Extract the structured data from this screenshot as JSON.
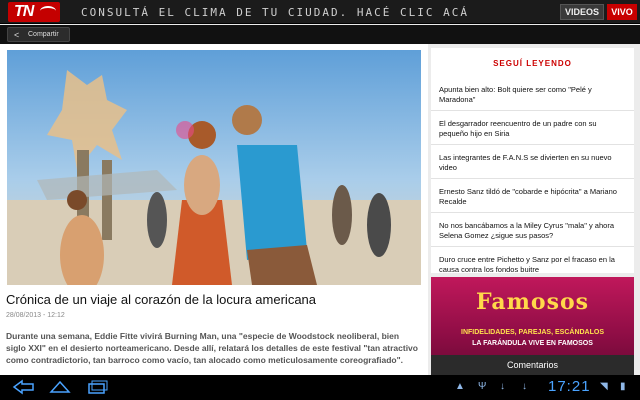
{
  "header": {
    "logo_text": "TN",
    "ticker": "CONSULTÁ EL CLIMA DE TU CIUDAD. HACÉ CLIC ACÁ",
    "videos_label": "VIDEOS",
    "vivo_label": "VIVO"
  },
  "share": {
    "label": "Compartir",
    "icon": "share-icon"
  },
  "article": {
    "title": "Crónica de un viaje al corazón de la locura americana",
    "date": "28/08/2013 - 12:12",
    "lead": "Durante una semana, Eddie Fitte vivirá Burning Man, una \"especie de Woodstock neoliberal, bien siglo XXI\" en el desierto norteamericano. Desde allí, relatará los detalles de este festival \"tan atractivo como contradictorio, tan barroco como vacío, tan alocado como meticulosamente coreografiado\"."
  },
  "sidebar": {
    "title": "SEGUÍ LEYENDO",
    "items": [
      {
        "label": "Apunta bien alto: Bolt quiere ser como \"Pelé y Maradona\""
      },
      {
        "label": "El desgarrador reencuentro de un padre con su pequeño hijo en Siria"
      },
      {
        "label": "Las integrantes de F.A.N.S se divierten en su nuevo video"
      },
      {
        "label": "Ernesto Sanz tildó de \"cobarde e hipócrita\" a Mariano Recalde"
      },
      {
        "label": "No nos bancábamos a la Miley Cyrus \"mala\" y ahora Selena Gomez ¿sigue sus pasos?"
      },
      {
        "label": "Duro cruce entre Pichetto y Sanz por el fracaso en la causa contra los fondos buitre"
      }
    ]
  },
  "ad": {
    "title": "Famosos",
    "line1": "INFIDELIDADES, PAREJAS, ESCÁNDALOS",
    "line2": "LA FARÁNDULA VIVE EN FAMOSOS"
  },
  "comments_label": "Comentarios",
  "system": {
    "time": "17:21",
    "icons": [
      "back-icon",
      "home-icon",
      "recent-apps-icon",
      "warning-icon",
      "usb-icon",
      "download-icon",
      "download-icon",
      "wifi-icon",
      "battery-icon"
    ]
  },
  "colors": {
    "brand_red": "#c40000",
    "accent_blue": "#4aa3ff",
    "ad_magenta": "#c0185b",
    "ad_yellow": "#ffd84a"
  }
}
